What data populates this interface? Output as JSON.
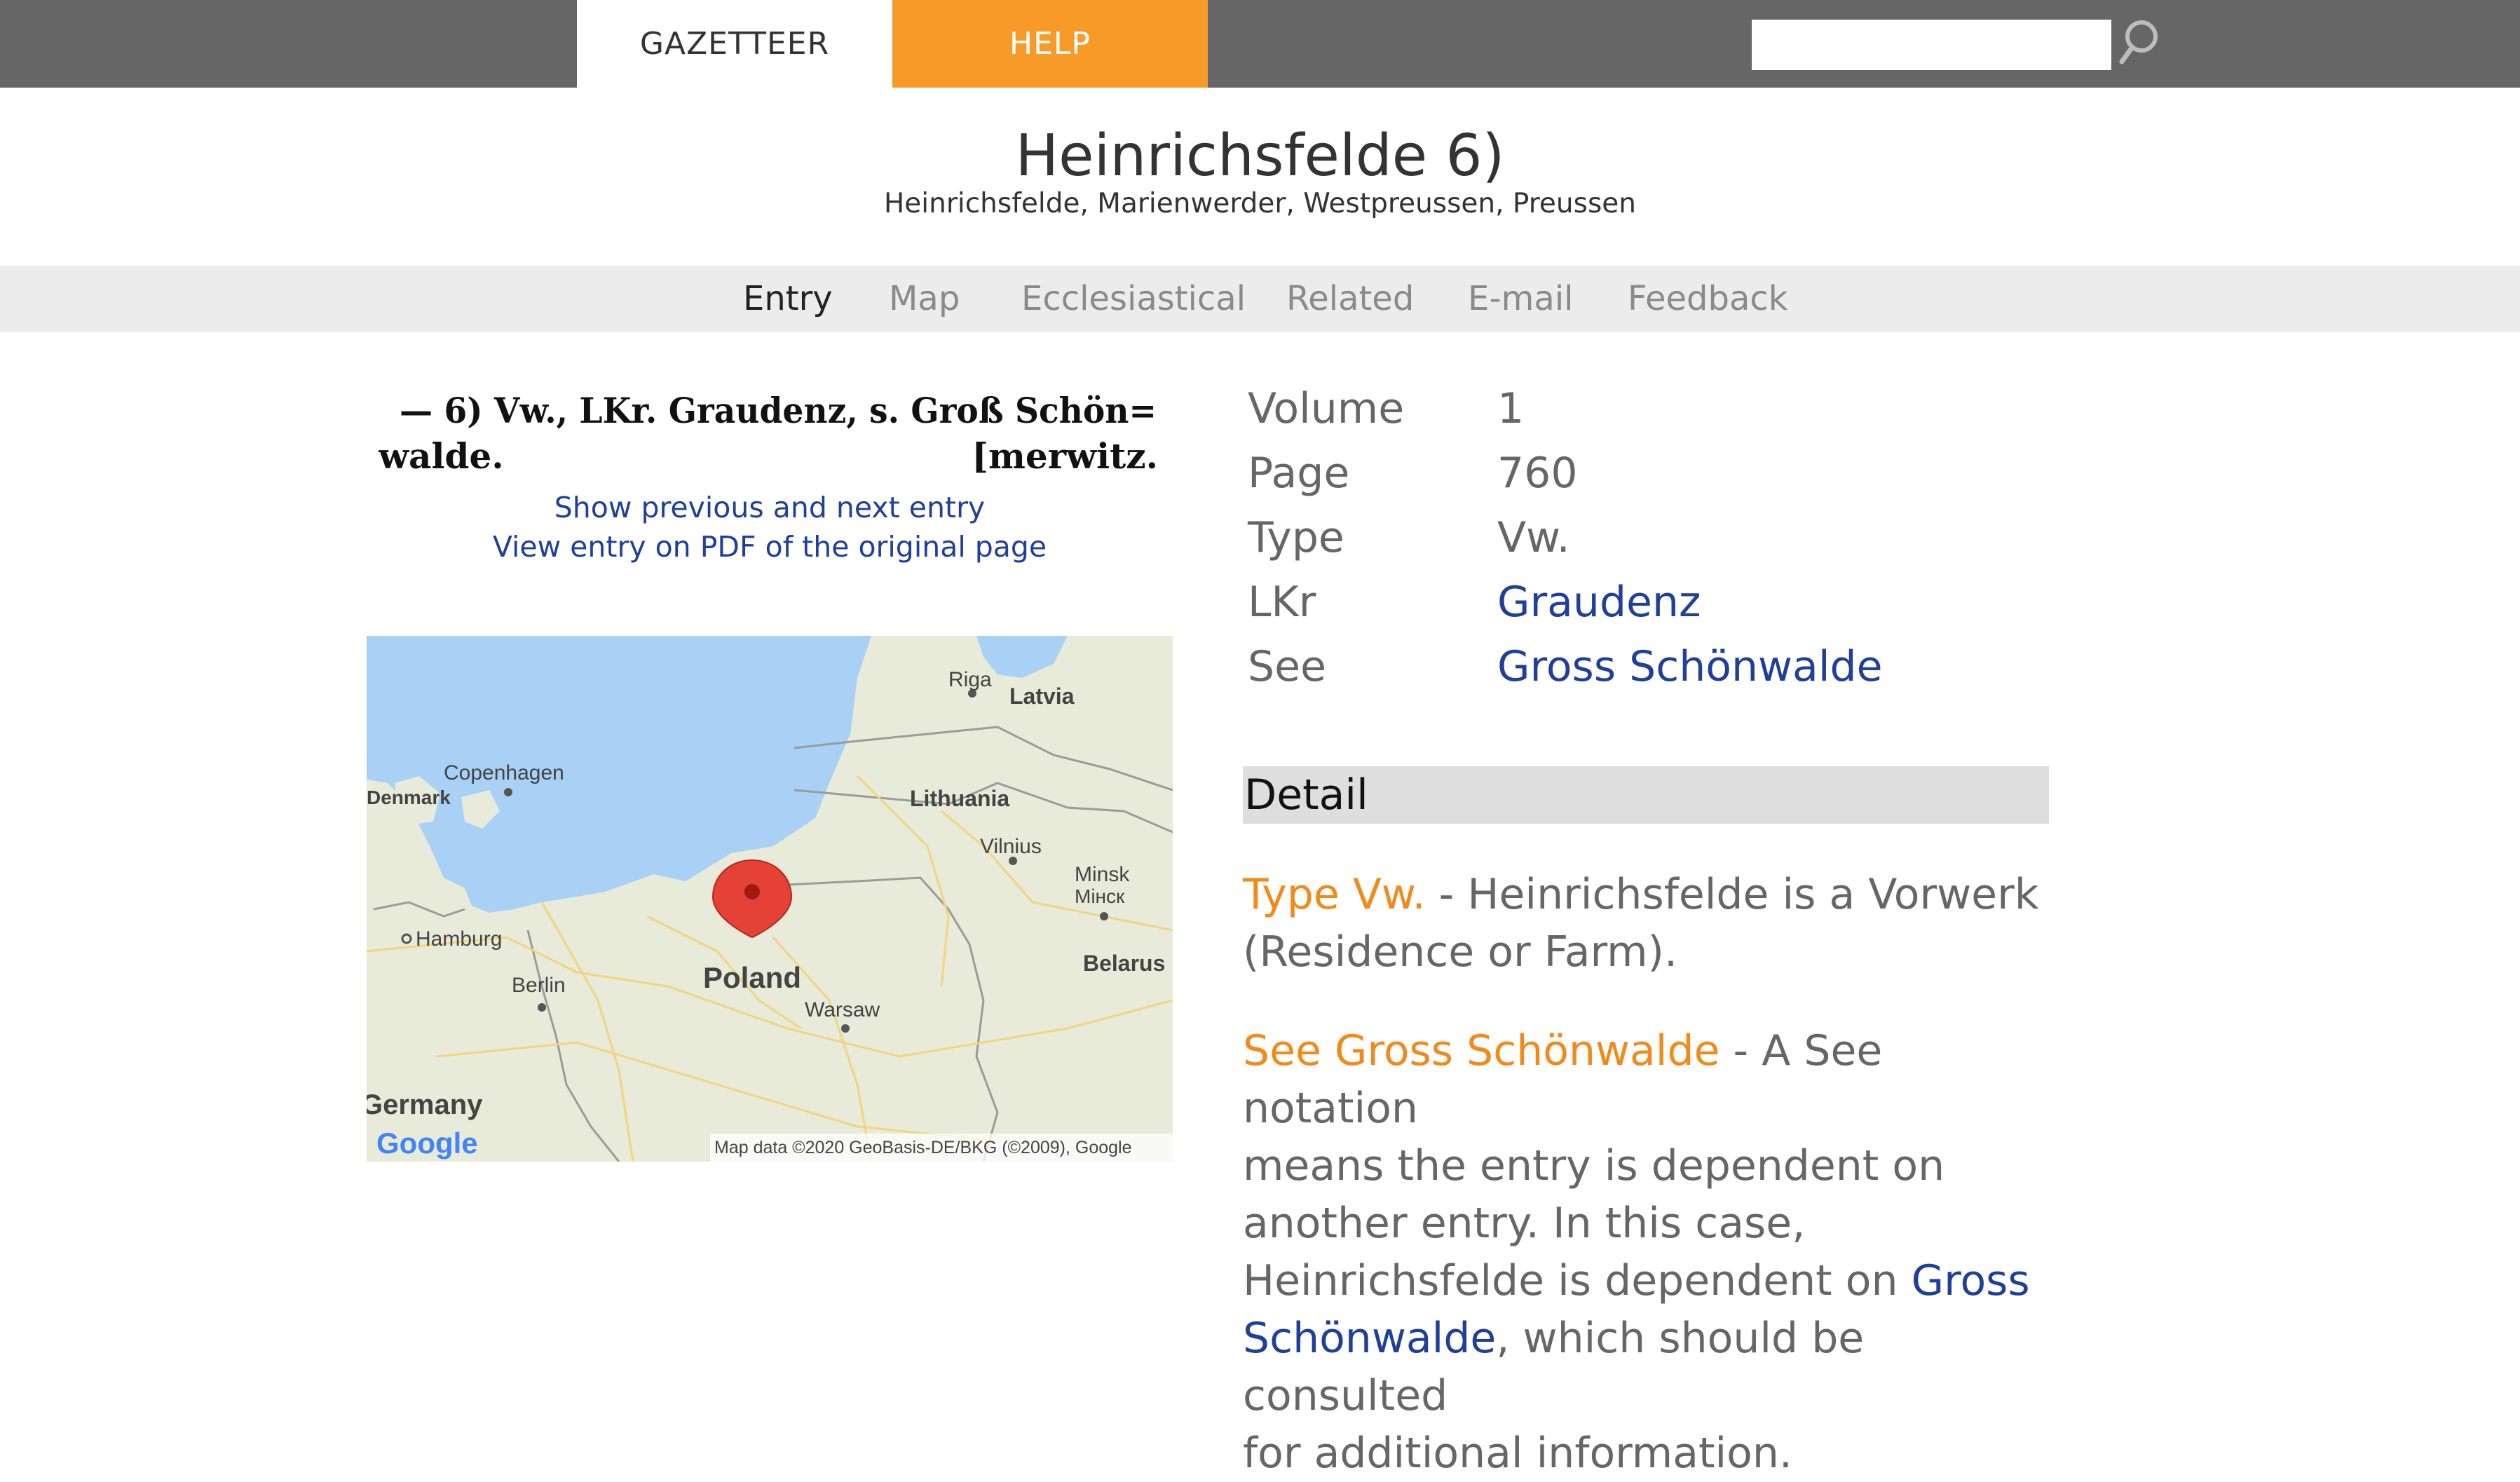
{
  "nav": {
    "gazetteer": "GAZETTEER",
    "help": "HELP",
    "search_value": "",
    "accent_color": "#f79a28"
  },
  "header": {
    "title": "Heinrichsfelde 6)",
    "subtitle": "Heinrichsfelde, Marienwerder, Westpreussen, Preussen"
  },
  "tabs": [
    "Entry",
    "Map",
    "Ecclesiastical",
    "Related",
    "E-mail",
    "Feedback"
  ],
  "active_tab": "Entry",
  "entry": {
    "scan_line1": "— 6) Vw., LKr. Graudenz, s. Groß Schön=",
    "scan_line2_left": "walde.",
    "scan_line2_right": "[merwitz.",
    "show_prev_next": "Show previous and next entry",
    "view_pdf": "View entry on PDF of the original page"
  },
  "map": {
    "labels": {
      "riga": "Riga",
      "latvia": "Latvia",
      "copenhagen": "Copenhagen",
      "denmark": "Denmark",
      "lithuania": "Lithuania",
      "vilnius": "Vilnius",
      "minsk": "Minsk",
      "minsk_cyr": "Мінск",
      "hamburg": "Hamburg",
      "berlin": "Berlin",
      "poland": "Poland",
      "belarus": "Belarus",
      "warsaw": "Warsaw",
      "germany": "Germany"
    },
    "logo": "Google",
    "attribution": "Map data ©2020 GeoBasis-DE/BKG (©2009), Google"
  },
  "details": [
    {
      "label": "Volume",
      "value": "1",
      "link": false
    },
    {
      "label": "Page",
      "value": "760",
      "link": false
    },
    {
      "label": "Type",
      "value": "Vw.",
      "link": false
    },
    {
      "label": "LKr",
      "value": "Graudenz",
      "link": true
    },
    {
      "label": "See",
      "value": "Gross Schönwalde",
      "link": true
    }
  ],
  "detail_section": {
    "heading": "Detail",
    "para1_term": "Type Vw.",
    "para1_text_a": " - Heinrichsfelde is a Vorwerk",
    "para1_text_b": "(Residence or Farm).",
    "para2_term": "See Gross Schönwalde",
    "para2_line1_rest": " - A See notation",
    "para2_line2": "means the entry is dependent on",
    "para2_line3": "another entry. In this case,",
    "para2_line4": "Heinrichsfelde is dependent on ",
    "para2_link_a": "Gross",
    "para2_link_b": "Schönwalde",
    "para2_line5_rest": ", which should be consulted",
    "para2_line6": "for additional information."
  }
}
